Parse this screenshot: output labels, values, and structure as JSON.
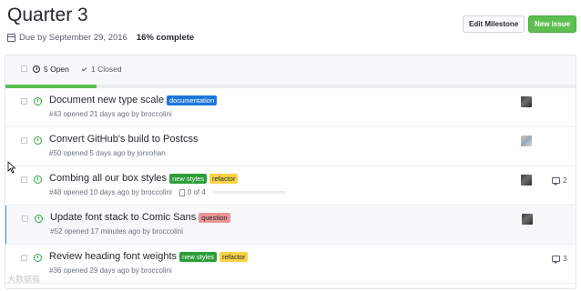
{
  "milestone": {
    "title": "Quarter 3",
    "due_text": "Due by September 29, 2016",
    "percent_text": "16% complete",
    "progress_fraction": 0.16
  },
  "buttons": {
    "edit_label": "Edit Milestone",
    "new_issue_label": "New issue"
  },
  "tabs": {
    "open_label": "5 Open",
    "closed_label": "1 Closed"
  },
  "issues": [
    {
      "title": "Document new type scale",
      "meta": "#43 opened 21 days ago by broccolini",
      "labels": [
        {
          "text": "documentation",
          "bg": "#1d76db",
          "fg": "#ffffff"
        }
      ],
      "avatar": "avatar-dark",
      "comments": null,
      "tasks": null,
      "highlighted": false
    },
    {
      "title": "Convert GitHub's build to Postcss",
      "meta": "#50 opened 5 days ago by jonrohan",
      "labels": [],
      "avatar": "avatar-light",
      "comments": null,
      "tasks": null,
      "highlighted": false
    },
    {
      "title": "Combing all our box styles",
      "meta": "#48 opened 10 days ago by broccolini",
      "labels": [
        {
          "text": "new styles",
          "bg": "#2c9e3a",
          "fg": "#ffffff"
        },
        {
          "text": "refactor",
          "bg": "#f9d348",
          "fg": "#24292e"
        }
      ],
      "avatar": "avatar-dark",
      "comments": "2",
      "tasks": "0 of 4",
      "highlighted": false
    },
    {
      "title": "Update font stack to Comic Sans",
      "meta": "#52 opened 17 minutes ago by broccolini",
      "labels": [
        {
          "text": "question",
          "bg": "#e99695",
          "fg": "#24292e"
        }
      ],
      "avatar": "avatar-dark",
      "comments": null,
      "tasks": null,
      "highlighted": true
    },
    {
      "title": "Review heading font weights",
      "meta": "#36 opened 29 days ago by broccolini",
      "labels": [
        {
          "text": "new styles",
          "bg": "#2c9e3a",
          "fg": "#ffffff"
        },
        {
          "text": "refactor",
          "bg": "#f9d348",
          "fg": "#24292e"
        }
      ],
      "avatar": null,
      "comments": "3",
      "tasks": null,
      "highlighted": false
    }
  ],
  "watermark": "大数据猫",
  "colors": {
    "accent_green": "#5cbf4f",
    "open_icon": "#28a745",
    "highlight_border": "#4a90d9"
  }
}
